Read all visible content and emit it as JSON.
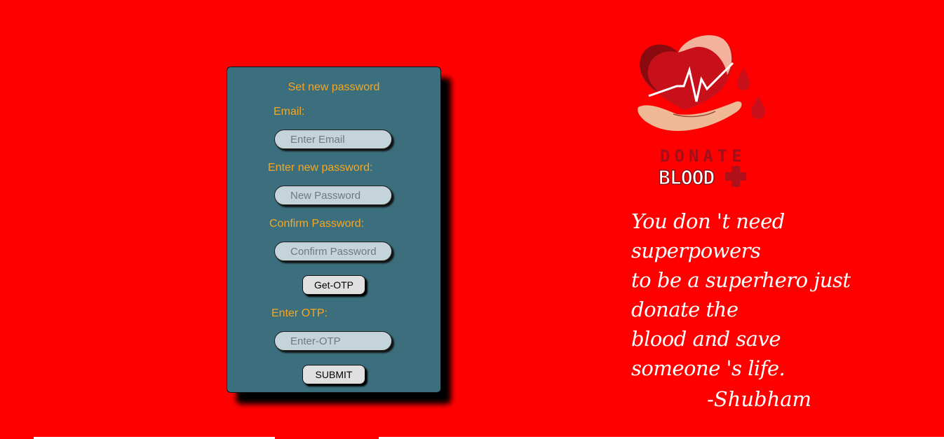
{
  "form": {
    "title": "Set new password",
    "email_label": "Email:",
    "email_placeholder": "Enter Email",
    "new_password_label": "Enter new password:",
    "new_password_placeholder": "New Password",
    "confirm_password_label": "Confirm Password:",
    "confirm_password_placeholder": "Confirm Password",
    "get_otp_button": "Get-OTP",
    "otp_label": "Enter OTP:",
    "otp_placeholder": "Enter-OTP",
    "submit_button": "SUBMIT"
  },
  "logo": {
    "line1": "DONATE",
    "line2": "BLOOD",
    "icon": "heart-in-hand-icon"
  },
  "quote": {
    "lines": [
      "You don 't need",
      "superpowers",
      "to be a superhero just",
      "donate the",
      "blood and save",
      "someone 's life."
    ],
    "author": "-Shubham"
  },
  "colors": {
    "background": "#ff0000",
    "card": "#3c6f7d",
    "label": "#f5a623",
    "input": "#c5d4da"
  }
}
